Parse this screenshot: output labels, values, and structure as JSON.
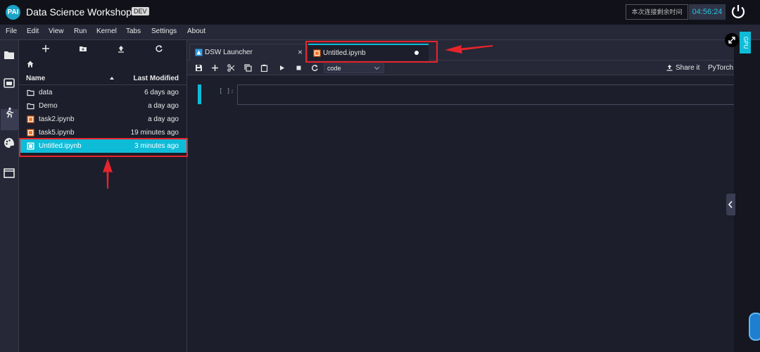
{
  "header": {
    "logo_text": "PAI",
    "app_title": "Data Science Workshop",
    "env_badge": "DEV",
    "remaining_label": "本次连接剩余时间",
    "remaining_time": "04:56:24"
  },
  "menu": [
    "File",
    "Edit",
    "View",
    "Run",
    "Kernel",
    "Tabs",
    "Settings",
    "About"
  ],
  "file_browser": {
    "col_name": "Name",
    "col_modified": "Last Modified",
    "rows": [
      {
        "name": "data",
        "modified": "6 days ago",
        "kind": "folder"
      },
      {
        "name": "Demo",
        "modified": "a day ago",
        "kind": "folder"
      },
      {
        "name": "task2.ipynb",
        "modified": "a day ago",
        "kind": "notebook"
      },
      {
        "name": "task5.ipynb",
        "modified": "19 minutes ago",
        "kind": "notebook"
      },
      {
        "name": "Untitled.ipynb",
        "modified": "3 minutes ago",
        "kind": "notebook",
        "selected": true
      }
    ]
  },
  "tabs": [
    {
      "label": "DSW Launcher",
      "icon": "launcher-icon",
      "close": "×"
    },
    {
      "label": "Untitled.ipynb",
      "icon": "notebook-icon",
      "active": true,
      "unsaved": true
    }
  ],
  "notebook_toolbar": {
    "cell_type": "code",
    "share_label": "Share it",
    "kernel_label": "PyTorch"
  },
  "cell": {
    "prompt": "[ ]:"
  },
  "right_panel": {
    "gpu_label": "GPU"
  },
  "colors": {
    "accent": "#0ebcd8",
    "highlight": "#e8242b",
    "background": "#1c1e2b"
  }
}
